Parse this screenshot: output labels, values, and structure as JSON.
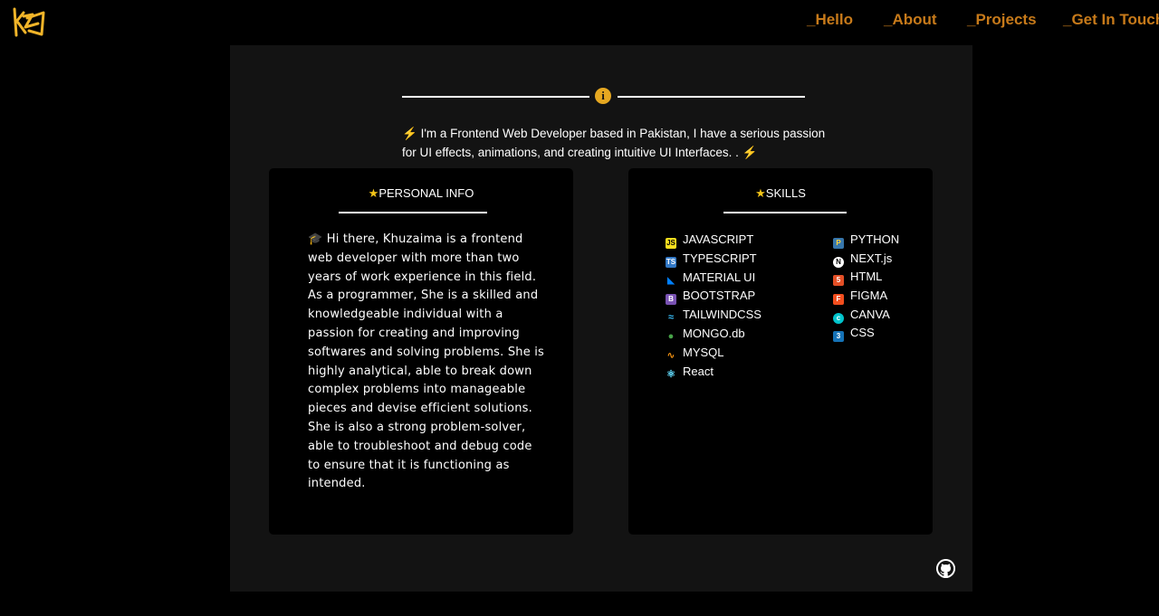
{
  "logo": {
    "name": "logo-icon",
    "color": "#f0b429"
  },
  "nav": {
    "items": [
      {
        "label": "_Hello"
      },
      {
        "label": "_About"
      },
      {
        "label": "_Projects"
      },
      {
        "label": "_Get In Touch"
      }
    ],
    "color": "#c77a1a"
  },
  "intro": {
    "icon": "info-icon",
    "text": "I'm a Frontend Web Developer based in Pakistan, I have a serious passion for UI effects, animations, and creating intuitive UI Interfaces. .",
    "accent": "#e6a821"
  },
  "personal": {
    "title": "PERSONAL INFO",
    "bio": "Hi there, Khuzaima is a frontend web developer with more than two years of work experience in this field. As a programmer, She is a skilled and knowledgeable individual with a passion for creating and improving softwares and solving problems. She is highly analytical, able to break down complex problems into manageable pieces and devise efficient solutions. She is also a strong problem-solver, able to troubleshoot and debug code to ensure that it is functioning as intended."
  },
  "skills": {
    "title": "SKILLS",
    "left": [
      {
        "label": "JAVASCRIPT",
        "icon": "javascript-icon",
        "color": "#f7df1e"
      },
      {
        "label": "TYPESCRIPT",
        "icon": "typescript-icon",
        "color": "#3178c6"
      },
      {
        "label": "MATERIAL UI",
        "icon": "material-ui-icon",
        "color": "#007fff"
      },
      {
        "label": "BOOTSTRAP",
        "icon": "bootstrap-icon",
        "color": "#7952b3"
      },
      {
        "label": "TAILWINDCSS",
        "icon": "tailwindcss-icon",
        "color": "#38bdf8"
      },
      {
        "label": "MONGO.db",
        "icon": "mongodb-icon",
        "color": "#47a248"
      },
      {
        "label": "MYSQL",
        "icon": "mysql-icon",
        "color": "#f29111"
      },
      {
        "label": "React",
        "icon": "react-icon",
        "color": "#61dafb"
      }
    ],
    "right": [
      {
        "label": "PYTHON",
        "icon": "python-icon",
        "color": "#3776ab"
      },
      {
        "label": "NEXT.js",
        "icon": "nextjs-icon",
        "color": "#ffffff"
      },
      {
        "label": "HTML",
        "icon": "html-icon",
        "color": "#e34f26"
      },
      {
        "label": "FIGMA",
        "icon": "figma-icon",
        "color": "#f24e1e"
      },
      {
        "label": "CANVA",
        "icon": "canva-icon",
        "color": "#00c4cc"
      },
      {
        "label": "CSS",
        "icon": "css-icon",
        "color": "#1572b6"
      }
    ]
  },
  "footer": {
    "icon": "github-icon"
  }
}
